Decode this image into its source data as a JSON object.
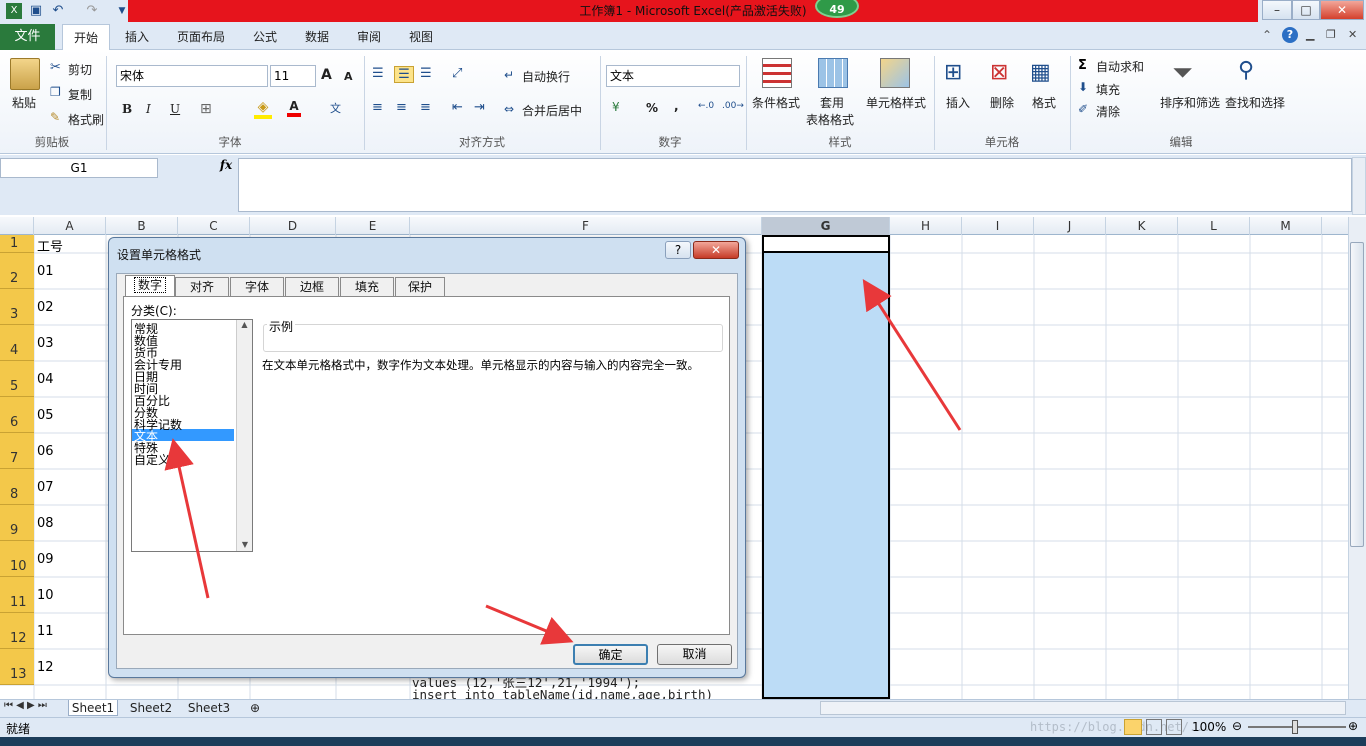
{
  "window": {
    "title": "工作簿1 - Microsoft Excel(产品激活失败)",
    "badge": "49"
  },
  "tabs": [
    {
      "label": "文件"
    },
    {
      "label": "开始"
    },
    {
      "label": "插入"
    },
    {
      "label": "页面布局"
    },
    {
      "label": "公式"
    },
    {
      "label": "数据"
    },
    {
      "label": "审阅"
    },
    {
      "label": "视图"
    }
  ],
  "ribbon": {
    "clipboard": {
      "paste": "粘贴",
      "cut": "剪切",
      "copy": "复制",
      "painter": "格式刷",
      "label": "剪贴板"
    },
    "font": {
      "name": "宋体",
      "size": "11",
      "bold": "B",
      "italic": "I",
      "underline": "U",
      "font_color": "A",
      "grow": "A",
      "shrink": "A",
      "label": "字体"
    },
    "align": {
      "wrap": "自动换行",
      "merge": "合并后居中",
      "label": "对齐方式"
    },
    "number": {
      "format": "文本",
      "percent": "%",
      "comma": ",",
      "label": "数字"
    },
    "styles": {
      "conditional": "条件格式",
      "table1": "套用",
      "table2": "表格格式",
      "cell_style": "单元格样式",
      "label": "样式"
    },
    "cells": {
      "insert": "插入",
      "delete": "删除",
      "format": "格式",
      "label": "单元格"
    },
    "edit": {
      "autosum": "自动求和",
      "fill": "填充",
      "clear": "清除",
      "sort": "排序和筛选",
      "find": "查找和选择",
      "label": "编辑"
    }
  },
  "formula": {
    "name_box": "G1",
    "fx": "fx"
  },
  "columns": [
    "A",
    "B",
    "C",
    "D",
    "E",
    "F",
    "G",
    "H",
    "I",
    "J",
    "K",
    "L",
    "M"
  ],
  "rows": [
    "1",
    "2",
    "3",
    "4",
    "5",
    "6",
    "7",
    "8",
    "9",
    "10",
    "11",
    "12",
    "13"
  ],
  "cells_a": [
    "工号",
    "01",
    "02",
    "03",
    "04",
    "05",
    "06",
    "07",
    "08",
    "09",
    "10",
    "11",
    "12"
  ],
  "cells_f": [
    "values (12,'张三12',21,'1994');",
    "insert into tableName(id,name,age,birth)"
  ],
  "sheets": [
    "Sheet1",
    "Sheet2",
    "Sheet3"
  ],
  "status": {
    "ready": "就绪",
    "zoom": "100%",
    "watermark": "https://blog.csdn.net/..."
  },
  "dialog": {
    "title": "设置单元格格式",
    "tabs": [
      "数字",
      "对齐",
      "字体",
      "边框",
      "填充",
      "保护"
    ],
    "category_label": "分类(C):",
    "categories": [
      "常规",
      "数值",
      "货币",
      "会计专用",
      "日期",
      "时间",
      "百分比",
      "分数",
      "科学记数",
      "文本",
      "特殊",
      "自定义"
    ],
    "selected": "文本",
    "sample_label": "示例",
    "description": "在文本单元格格式中，数字作为文本处理。单元格显示的内容与输入的内容完全一致。",
    "ok": "确定",
    "cancel": "取消"
  },
  "colors": {
    "accent": "#2a7a3c",
    "title_bar": "#e6141c",
    "selection": "#bcdcf6",
    "arrow": "#e8383a"
  }
}
